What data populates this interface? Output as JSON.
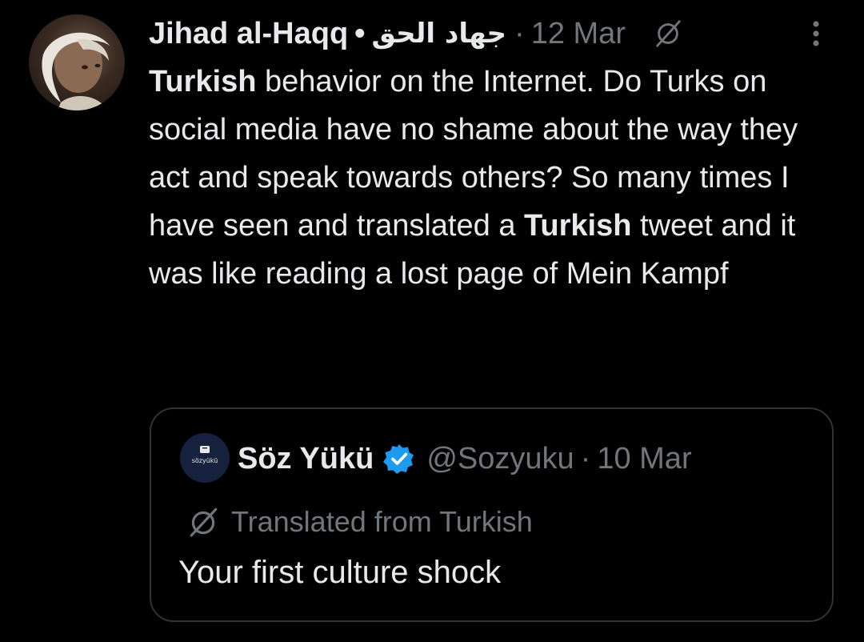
{
  "tweet": {
    "author": {
      "display_name": "Jihad al-Haqq",
      "arabic_name": "جهاد الحق",
      "avatar": "user-avatar"
    },
    "separator": "•",
    "meta_dot": "·",
    "date": "12 Mar",
    "icons": {
      "translate": "translate-icon",
      "more": "more-options-icon"
    },
    "text_segments": [
      {
        "text": "Turkish",
        "bold": true
      },
      {
        "text": " behavior on the Internet. Do Turks on social media have no shame about the way they act and speak towards others? So many times I have seen and translated a ",
        "bold": false
      },
      {
        "text": "Turkish",
        "bold": true
      },
      {
        "text": " tweet and it was like reading a lost page of Mein Kampf",
        "bold": false
      }
    ]
  },
  "quoted_tweet": {
    "author": {
      "display_name": "Söz Yükü",
      "handle": "@Sozyuku",
      "verified": true,
      "avatar_text": "sözyükü"
    },
    "meta_dot": "·",
    "date": "10 Mar",
    "translated_label": "Translated from Turkish",
    "text": "Your first culture shock"
  },
  "colors": {
    "background": "#000000",
    "primary_text": "#e7e9ea",
    "secondary_text": "#71767b",
    "border": "#2f3336",
    "verified_blue": "#1d9bf0"
  }
}
